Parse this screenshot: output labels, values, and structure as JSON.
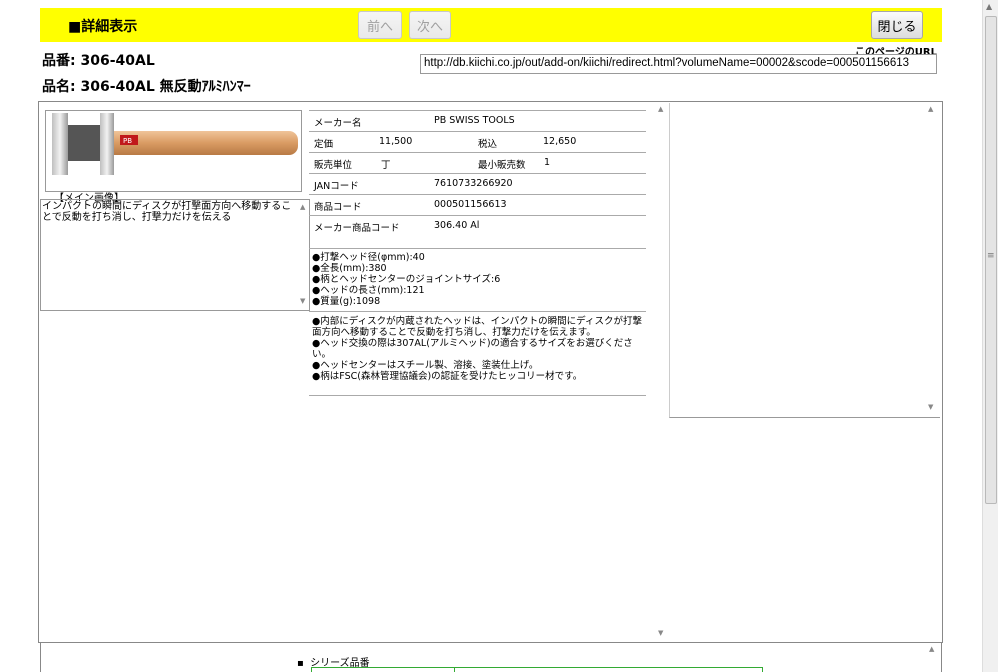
{
  "header": {
    "title": "■詳細表示",
    "prev_label": "前へ",
    "next_label": "次へ",
    "close_label": "閉じる"
  },
  "product": {
    "code_line": "品番: 306-40AL",
    "name_line": "品名: 306-40AL 無反動ｱﾙﾐﾊﾝﾏｰ"
  },
  "page_url": {
    "label": "このページのURL",
    "value": "http://db.kiichi.co.jp/out/add-on/kiichi/redirect.html?volumeName=00002&scode=000501156613"
  },
  "image": {
    "caption": "【メイン画像】",
    "brand_tag": "PB"
  },
  "description": "インパクトの瞬間にディスクが打撃面方向へ移動することで反動を打ち消し、打撃力だけを伝える",
  "spec": {
    "maker_label": "メーカー名",
    "maker_value": "PB SWISS TOOLS",
    "price_label": "定価",
    "price_value": "11,500",
    "tax_label": "税込",
    "tax_value": "12,650",
    "unit_label": "販売単位",
    "unit_value": "丁",
    "min_label": "最小販売数",
    "min_value": "1",
    "jan_label": "JANコード",
    "jan_value": "7610733266920",
    "item_code_label": "商品コード",
    "item_code_value": "000501156613",
    "maker_code_label": "メーカー商品コード",
    "maker_code_value": "306.40 Al"
  },
  "features": [
    "●打撃ヘッド径(φmm):40",
    "●全長(mm):380",
    "●柄とヘッドセンターのジョイントサイズ:6",
    "●ヘッドの長さ(mm):121",
    "●質量(g):1098"
  ],
  "notes": [
    "●内部にディスクが内蔵されたヘッドは、インパクトの瞬間にディスクが打撃面方向へ移動することで反動を打ち消し、打撃力だけを伝えます。",
    "●ヘッド交換の際は307AL(アルミヘッド)の適合するサイズをお選びください。",
    "●ヘッドセンターはスチール製、溶接、塗装仕上げ。",
    "●柄はFSC(森林管理協議会)の認証を受けたヒッコリー材です。"
  ],
  "series": {
    "label": "シリーズ品番"
  }
}
